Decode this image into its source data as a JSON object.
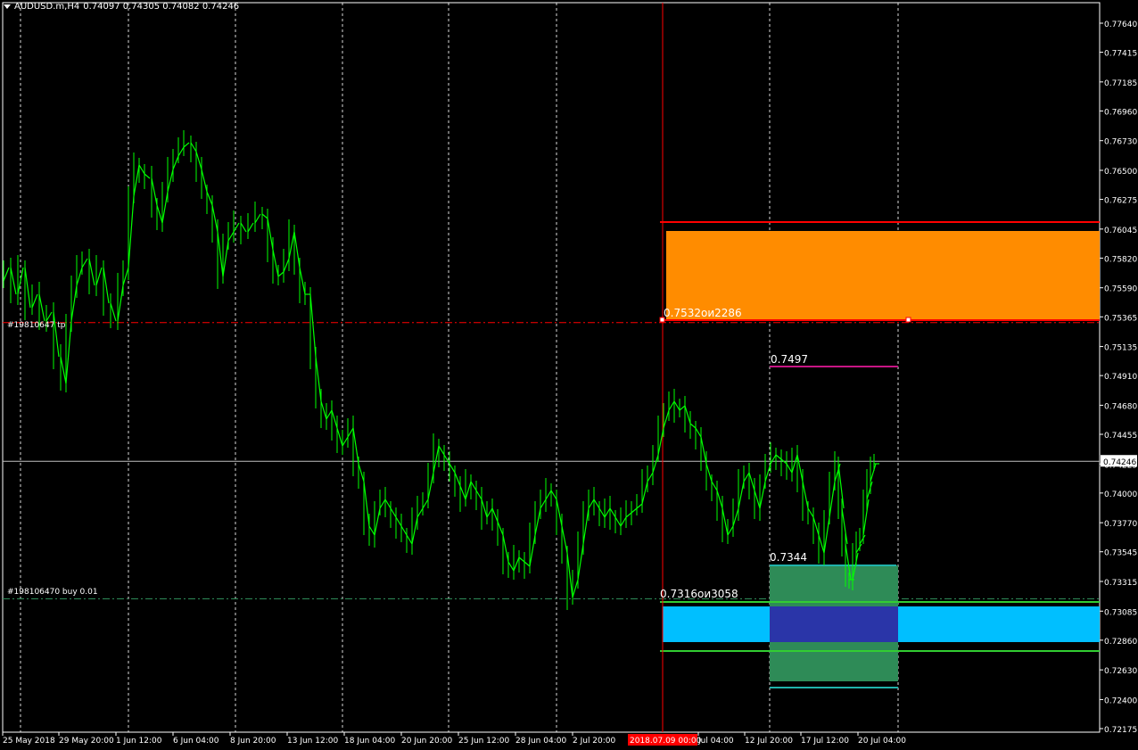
{
  "header": {
    "symbol": "AUDUSD.m,H4",
    "ohlc": "0.74097 0.74305 0.74082 0.74246"
  },
  "price_axis": {
    "ticks": [
      "0.77640",
      "0.77415",
      "0.77185",
      "0.76960",
      "0.76730",
      "0.76500",
      "0.76275",
      "0.76045",
      "0.75820",
      "0.75590",
      "0.75365",
      "0.75135",
      "0.74910",
      "0.74680",
      "0.74455",
      "0.74225",
      "0.74000",
      "0.73770",
      "0.73545",
      "0.73315",
      "0.73085",
      "0.72860",
      "0.72630",
      "0.72400",
      "0.72175"
    ],
    "tick_values": [
      0.7764,
      0.77415,
      0.77185,
      0.7696,
      0.7673,
      0.765,
      0.76275,
      0.76045,
      0.7582,
      0.7559,
      0.75365,
      0.75135,
      0.7491,
      0.7468,
      0.74455,
      0.74225,
      0.74,
      0.7377,
      0.73545,
      0.73315,
      0.73085,
      0.7286,
      0.7263,
      0.724,
      0.72175
    ],
    "current_price_label": "0.74246",
    "current_price": 0.74246
  },
  "time_axis": {
    "labels": [
      "25 May 2018",
      "29 May 20:00",
      "1 Jun 12:00",
      "6 Jun 04:00",
      "8 Jun 20:00",
      "13 Jun 12:00",
      "18 Jun 04:00",
      "20 Jun 20:00",
      "25 Jun 12:00",
      "28 Jun 04:00",
      "2 Jul 20:00",
      "Jul 04:00",
      "12 Jul 20:00",
      "17 Jul 12:00",
      "20 Jul 04:00"
    ],
    "cursor_label": "2018.07.09 00:00"
  },
  "orders": {
    "tp_label": "#19810647 tp",
    "tp_price": 0.7532,
    "buy_label": "#198106470 buy 0.01",
    "buy_price": 0.7318
  },
  "annotations": {
    "upper_zone_label": "0.7532ои2286",
    "mid_level_label": "0.7497",
    "lower_box_label": "0.7344",
    "lower_zone_label": "0.7316ои3058"
  },
  "colors": {
    "background": "#000000",
    "candles": "#00ff00",
    "grid": "#ffffff",
    "upper_zone": "#ff8c00",
    "lower_zone": "#00bfff",
    "green_box": "#2e8b57",
    "overlap": "#2a35a8",
    "red_line": "#ff0000",
    "magenta_line": "#c71585",
    "cursor_label_bg": "#ff0000"
  }
}
